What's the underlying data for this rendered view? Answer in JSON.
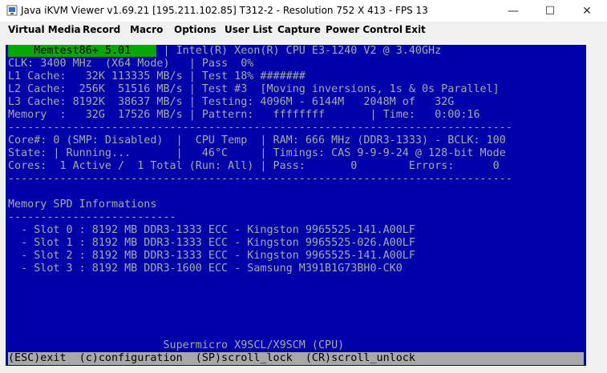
{
  "window": {
    "title": "Java iKVM Viewer v1.69.21 [195.211.102.85]  T312-2 - Resolution 752 X 413 - FPS 13",
    "min_glyph": "—",
    "max_glyph": "☐",
    "close_glyph": "✕"
  },
  "menu": {
    "items": [
      "Virtual Media",
      "Record",
      "Macro",
      "Options",
      "User List",
      "Capture",
      "Power Control",
      "Exit"
    ]
  },
  "memtest": {
    "brand": "    Memtest86+ 5.01    ",
    "lines": [
      " | Intel(R) Xeon(R) CPU E3-1240 V2 @ 3.40GHz",
      "CLK: 3400 MHz  (X64 Mode)   | Pass  0%",
      "L1 Cache:   32K 113335 MB/s | Test 18% #######",
      "L2 Cache:  256K  51516 MB/s | Test #3  [Moving inversions, 1s & 0s Parallel]",
      "L3 Cache: 8192K  38637 MB/s | Testing: 4096M - 6144M   2048M of   32G",
      "Memory  :   32G  17526 MB/s | Pattern:   ffffffff       | Time:   0:00:16",
      "------------------------------------------------------------------------------",
      "Core#: 0 (SMP: Disabled)  |  CPU Temp  | RAM: 666 MHz (DDR3-1333) - BCLK: 100",
      "State: | Running...       |   46°C     | Timings: CAS 9-9-9-24 @ 128-bit Mode",
      "Cores:  1 Active /  1 Total (Run: All) | Pass:       0        Errors:      0",
      "------------------------------------------------------------------------------",
      "",
      "Memory SPD Informations",
      "--------------------------",
      "  - Slot 0 : 8192 MB DDR3-1333 ECC - Kingston 9965525-141.A00LF",
      "  - Slot 1 : 8192 MB DDR3-1333 ECC - Kingston 9965525-026.A00LF",
      "  - Slot 2 : 8192 MB DDR3-1333 ECC - Kingston 9965525-141.A00LF",
      "  - Slot 3 : 8192 MB DDR3-1600 ECC - Samsung M391B1G73BH0-CK0"
    ],
    "board": "                        Supermicro X9SCL/X9SCM (CPU)",
    "footer": "(ESC)exit  (c)configuration  (SP)scroll_lock  (CR)scroll_unlock"
  }
}
